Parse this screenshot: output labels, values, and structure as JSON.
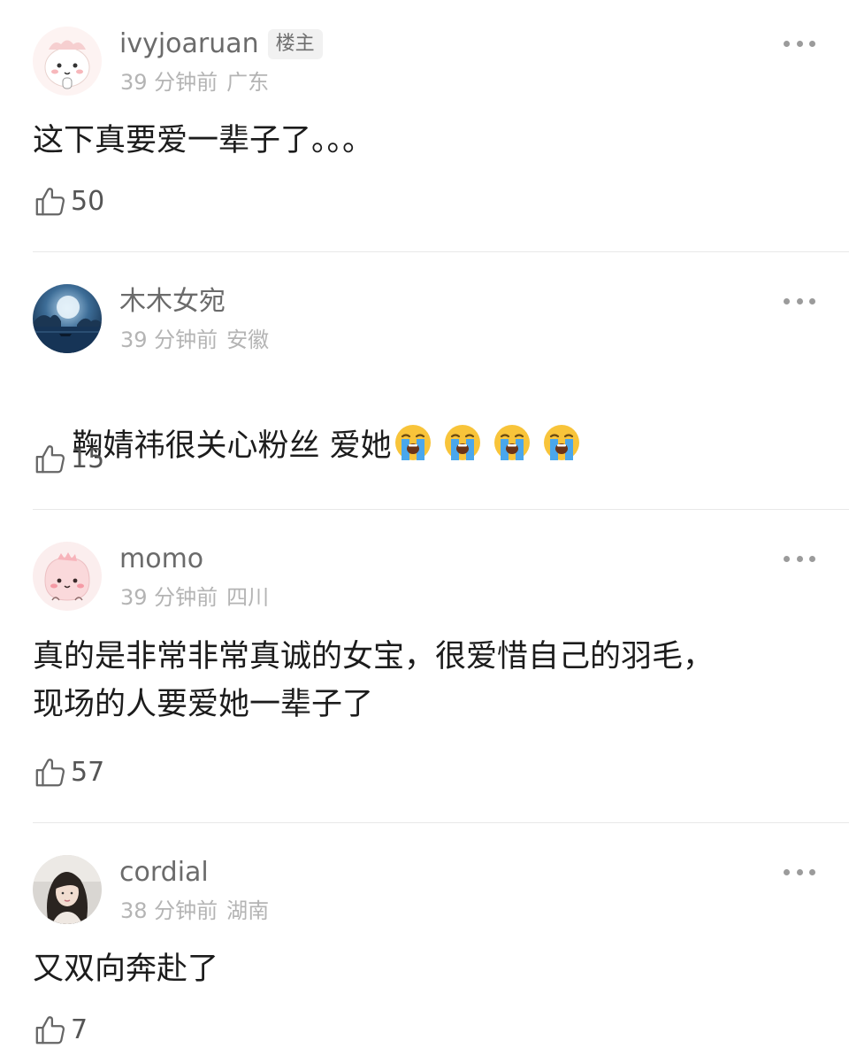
{
  "comments": [
    {
      "username": "ivyjoaruan",
      "badge": "楼主",
      "time": "39 分钟前",
      "location": "广东",
      "text": "这下真要爱一辈子了。。。",
      "likes": "50",
      "avatar_icon": "cartoon-bunny-avatar"
    },
    {
      "username": "木木女宛",
      "time": "39 分钟前",
      "location": "安徽",
      "text": "鞠婧祎很关心粉丝 爱她",
      "emoji": [
        "loudly-crying-face",
        "loudly-crying-face",
        "loudly-crying-face",
        "loudly-crying-face"
      ],
      "likes": "15",
      "avatar_icon": "moonlit-sea-avatar"
    },
    {
      "username": "momo",
      "time": "39 分钟前",
      "location": "四川",
      "text": "真的是非常非常真诚的女宝，很爱惜自己的羽毛，\n现场的人要爱她一辈子了",
      "likes": "57",
      "avatar_icon": "pink-dino-avatar"
    },
    {
      "username": "cordial",
      "time": "38 分钟前",
      "location": "湖南",
      "text": "又双向奔赴了",
      "likes": "7",
      "avatar_icon": "photo-portrait-avatar"
    }
  ],
  "colors": {
    "username": "#6b6b6b",
    "meta": "#b4b4b4",
    "text": "#1c1c1c",
    "divider": "#e8e8e8"
  }
}
